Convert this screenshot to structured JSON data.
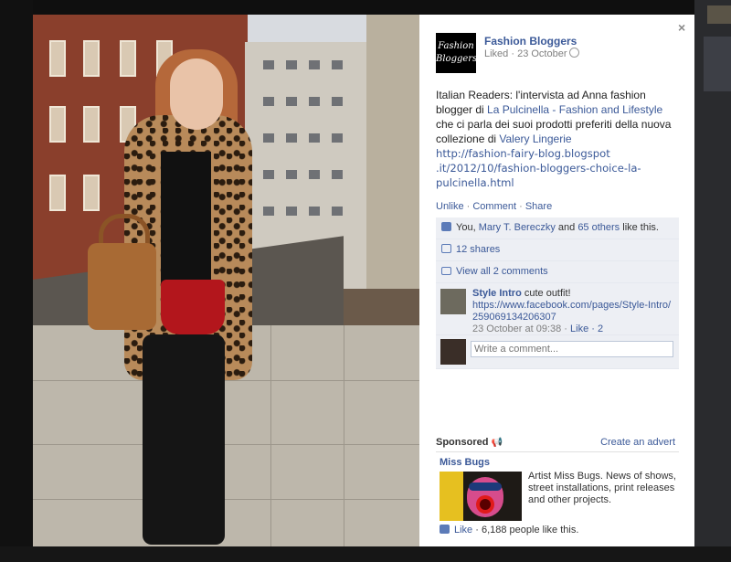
{
  "post": {
    "page_name": "Fashion Bloggers",
    "logo_line1": "Fashion",
    "logo_line2": "Bloggers",
    "meta": "Liked · 23 October",
    "text_before_link1": "Italian Readers: l'intervista ad Anna fashion blogger di ",
    "link1": "La Pulcinella - Fashion and Lifestyle",
    "text_between": " che ci parla dei suoi prodotti preferiti della nuova collezione di ",
    "link2": "Valery Lingerie",
    "url_line1": "http://fashion-fairy-blog.blogspot",
    "url_line2": ".it/2012/10/fashion-bloggers-choice-la-",
    "url_line3": "pulcinella.html"
  },
  "actions": {
    "unlike": "Unlike",
    "comment": "Comment",
    "share": "Share",
    "sep": " · "
  },
  "ufi": {
    "likes_prefix": "You, ",
    "likes_person": "Mary T. Bereczky",
    "likes_and": " and ",
    "likes_others": "65 others",
    "likes_suffix": " like this.",
    "shares": "12 shares",
    "view_comments": "View all 2 comments",
    "comment_author": "Style Intro",
    "comment_text": " cute outfit!",
    "comment_link": "https://www.facebook.com/pages/Style-Intro/259069134206307",
    "comment_time": "23 October at 09:38 · ",
    "comment_like": "Like",
    "comment_like_count": " · 2",
    "write_placeholder": "Write a comment..."
  },
  "sponsored": {
    "label": "Sponsored",
    "create_ad": "Create an advert",
    "ad_title": "Miss Bugs",
    "ad_text": "Artist Miss Bugs. News of shows, street installations, print releases and other projects.",
    "ad_like": "Like",
    "ad_like_count": " · 6,188 people like this."
  },
  "icons": {
    "close": "×",
    "megaphone": "📢"
  }
}
